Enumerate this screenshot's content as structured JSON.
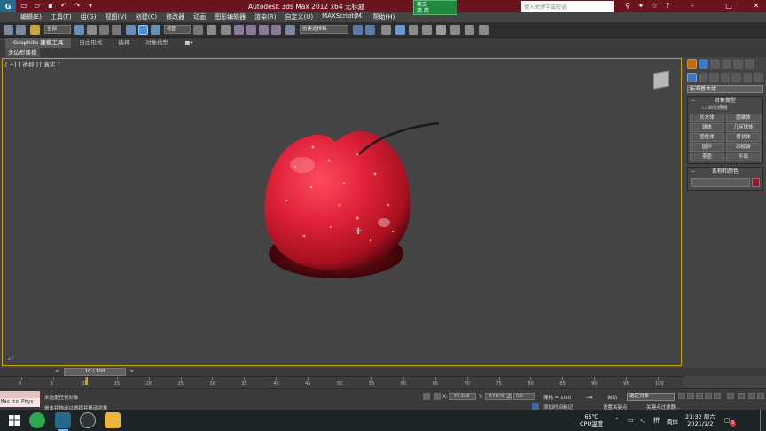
{
  "titlebar": {
    "title": "Autodesk 3ds Max  2012 x64     无标题",
    "app_logo": "G",
    "ime_line1": "英文",
    "ime_line2": "简 简",
    "search_placeholder": "键入关键字或短语"
  },
  "menu": [
    "编辑(E)",
    "工具(T)",
    "组(G)",
    "视图(V)",
    "创建(C)",
    "修改器",
    "动画",
    "图形编辑器",
    "渲染(R)",
    "自定义(U)",
    "MAXScript(M)",
    "帮助(H)"
  ],
  "toolbar": {
    "selection_filter": "全部",
    "ref_coord": "视图",
    "named_selection": "创建选择集"
  },
  "ribbon": {
    "tabs": [
      "Graphite 建模工具",
      "自由形式",
      "选择",
      "对象绘制"
    ],
    "subtab": "多边形建模"
  },
  "viewport": {
    "label": "[ +] [ 透视 ] [ 真实 ]",
    "axis": "z"
  },
  "command_panel": {
    "category_dropdown": "标准基本体",
    "object_type_title": "对象类型",
    "autogrid_label": "自动栅格",
    "objects": [
      "长方体",
      "圆锥体",
      "球体",
      "几何球体",
      "圆柱体",
      "管状体",
      "圆环",
      "四棱锥",
      "茶壶",
      "平面"
    ],
    "name_color_title": "名称和颜色",
    "object_color": "#a0102e"
  },
  "timeline": {
    "slider_label": "10 / 100",
    "ticks": [
      "0",
      "5",
      "10",
      "15",
      "20",
      "25",
      "30",
      "35",
      "40",
      "45",
      "50",
      "55",
      "60",
      "65",
      "70",
      "75",
      "80",
      "85",
      "90",
      "95",
      "100"
    ]
  },
  "status": {
    "maxscript_label": "Max to Phys",
    "line1": "未选定任何对象",
    "line2": "单击并拖动以选择并移动对象",
    "x_label": "X:",
    "x_value": "-74.118",
    "y_label": "Y:",
    "y_value": "-57.648",
    "z_label": "Z:",
    "z_value": "0.0",
    "grid": "栅格 = 10.0",
    "add_time_tag": "添加时间标记",
    "auto_key": "自动",
    "set_key": "设置关键点",
    "selection_dropdown": "选定对象",
    "key_filters": "关键点过滤器..."
  },
  "taskbar": {
    "temp": "65℃",
    "temp_label": "CPU温度",
    "lang": "简体",
    "time": "21:32 周六",
    "date": "2021/1/2",
    "notifications": "3"
  }
}
